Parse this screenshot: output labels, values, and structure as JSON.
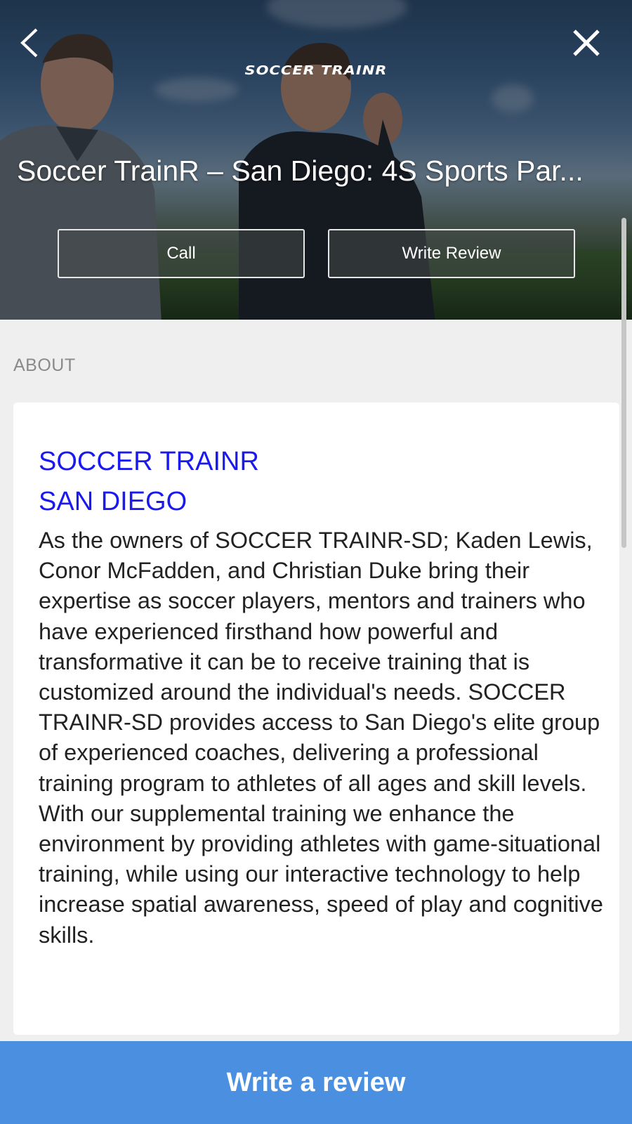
{
  "header": {
    "brand": "SOCCER TRAINR",
    "title": "Soccer TrainR – San Diego: 4S Sports Par...",
    "call_label": "Call",
    "write_review_label": "Write Review",
    "back_icon": "chevron-left-icon",
    "close_icon": "close-icon"
  },
  "about": {
    "section_label": "ABOUT",
    "heading_line1": "SOCCER TRAINR",
    "heading_line2": "SAN DIEGO",
    "body": "As the owners of SOCCER TRAINR-SD; Kaden Lewis, Conor McFadden, and Christian Duke bring their expertise as soccer players, mentors and trainers who have experienced firsthand how powerful and transformative it can be to receive training that is customized around the individual's needs. SOCCER TRAINR-SD provides access to San Diego's elite group of experienced coaches, delivering a professional training program to athletes of all ages and skill levels. With our supplemental training we enhance the environment by providing athletes with game-situational training, while using our interactive technology to help increase spatial awareness, speed of play and cognitive skills."
  },
  "footer": {
    "cta_label": "Write a review"
  },
  "colors": {
    "accent_blue": "#4a8fe0",
    "heading_blue": "#1a1aee",
    "background": "#efefef"
  }
}
